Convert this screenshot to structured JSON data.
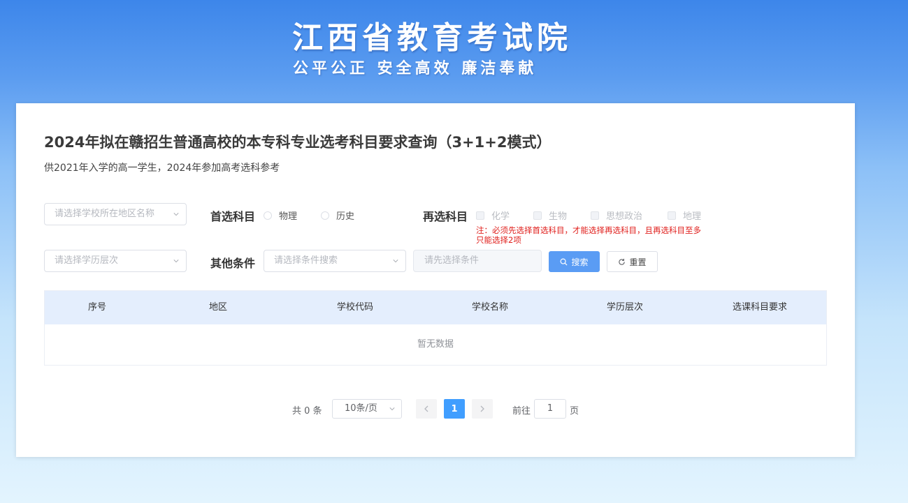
{
  "banner": {
    "title": "江西省教育考试院",
    "slogan": "公平公正 安全高效 廉洁奉献"
  },
  "page": {
    "title": "2024年拟在赣招生普通高校的本专科专业选考科目要求查询（3+1+2模式）",
    "subtitle": "供2021年入学的高一学生，2024年参加高考选科参考"
  },
  "filters": {
    "region_placeholder": "请选择学校所在地区名称",
    "level_placeholder": "请选择学历层次",
    "first_subject_label": "首选科目",
    "first_subject_options": [
      "物理",
      "历史"
    ],
    "second_subject_label": "再选科目",
    "second_subject_options": [
      "化学",
      "生物",
      "思想政治",
      "地理"
    ],
    "note": "注：必须先选择首选科目，才能选择再选科目，且再选科目至多只能选择2项",
    "other_label": "其他条件",
    "condition_placeholder": "请选择条件搜索",
    "condition_value_placeholder": "请先选择条件",
    "search_label": "搜索",
    "reset_label": "重置"
  },
  "table": {
    "columns": [
      "序号",
      "地区",
      "学校代码",
      "学校名称",
      "学历层次",
      "选课科目要求"
    ],
    "empty_text": "暂无数据"
  },
  "pagination": {
    "total_text": "共 0 条",
    "page_size": "10条/页",
    "current_page": "1",
    "goto_prefix": "前往",
    "goto_value": "1",
    "goto_suffix": "页"
  },
  "colors": {
    "primary": "#409eff",
    "search_button": "#5a9cf4",
    "note_red": "#e0201d",
    "table_header_bg": "#e4eefd"
  },
  "icons": {
    "search": "search-icon",
    "reset": "refresh-icon",
    "prev": "chevron-left-icon",
    "next": "chevron-right-icon",
    "dropdown": "chevron-down-icon"
  }
}
